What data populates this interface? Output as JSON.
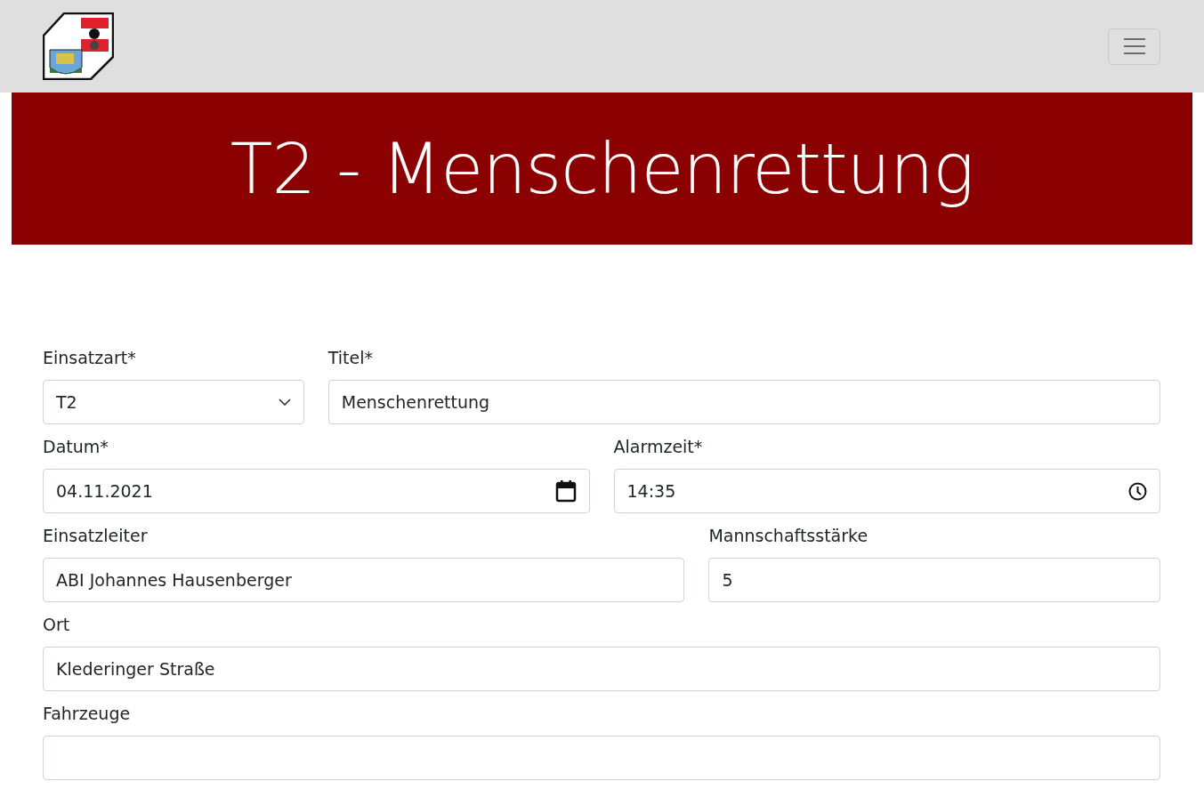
{
  "banner": {
    "title": "T2 - Menschenrettung"
  },
  "form": {
    "fields": [
      {
        "label": "Einsatzart*",
        "kind": "select",
        "value": "T2"
      },
      {
        "label": "Titel*",
        "kind": "text",
        "value": "Menschenrettung"
      },
      {
        "label": "Datum*",
        "kind": "date",
        "value": "04.11.2021"
      },
      {
        "label": "Alarmzeit*",
        "kind": "time",
        "value": "14:35"
      },
      {
        "label": "Einsatzleiter",
        "kind": "text",
        "value": "ABI Johannes Hausenberger"
      },
      {
        "label": "Mannschaftsstärke",
        "kind": "text",
        "value": "5"
      },
      {
        "label": "Ort",
        "kind": "text",
        "value": "Klederinger Straße"
      },
      {
        "label": "Fahrzeuge",
        "kind": "text"
      }
    ]
  }
}
